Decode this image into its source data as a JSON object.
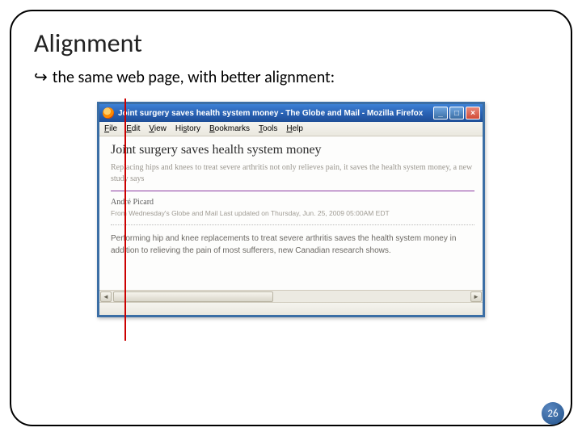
{
  "slide": {
    "title": "Alignment",
    "bullet_glyph": "↪",
    "bullet_text": "the same web page, with better alignment:",
    "page_number": "26"
  },
  "browser": {
    "title": "Joint surgery saves health system money - The Globe and Mail - Mozilla Firefox",
    "window_controls": {
      "min": "_",
      "max": "□",
      "close": "×"
    },
    "menu": {
      "file": "File",
      "edit": "Edit",
      "view": "View",
      "history": "History",
      "bookmarks": "Bookmarks",
      "tools": "Tools",
      "help": "Help"
    }
  },
  "article": {
    "headline": "Joint surgery saves health system money",
    "subhead": "Replacing hips and knees to treat severe arthritis not only relieves pain, it saves the health system money, a new study says",
    "author": "André Picard",
    "source_prefix": "From Wednesday's Globe and Mail",
    "updated": "Last updated on Thursday, Jun. 25, 2009 05:00AM EDT",
    "body": "Performing hip and knee replacements to treat severe arthritis saves the health system money in addition to relieving the pain of most sufferers, new Canadian research shows."
  },
  "scrollbar": {
    "left": "◄",
    "right": "►"
  }
}
